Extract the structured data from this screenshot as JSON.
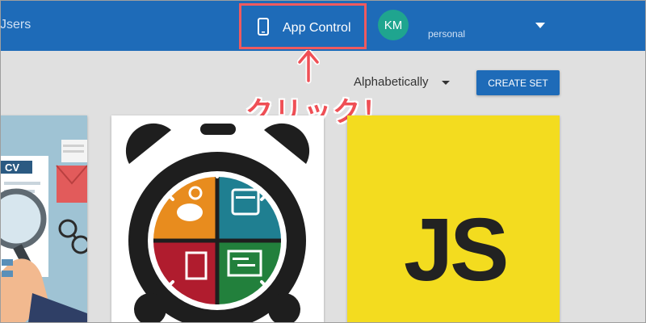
{
  "topbar": {
    "nav_partial": "Jsers",
    "app_control_label": "App Control",
    "avatar_initials": "KM",
    "account_subtitle": "personal"
  },
  "toolbar": {
    "sort_label": "Alphabetically",
    "create_set_label": "CREATE SET"
  },
  "annotation": {
    "arrow": "↑",
    "text": "クリック！"
  },
  "cards": [
    {
      "name": "cv-card",
      "visible_text": "CV"
    },
    {
      "name": "clock-card"
    },
    {
      "name": "js-card",
      "visible_text": "JS"
    }
  ],
  "colors": {
    "topbar": "#1e6bb8",
    "highlight": "#ef5a5f",
    "avatar": "#1fa58f",
    "js_yellow": "#f3dc1f"
  }
}
